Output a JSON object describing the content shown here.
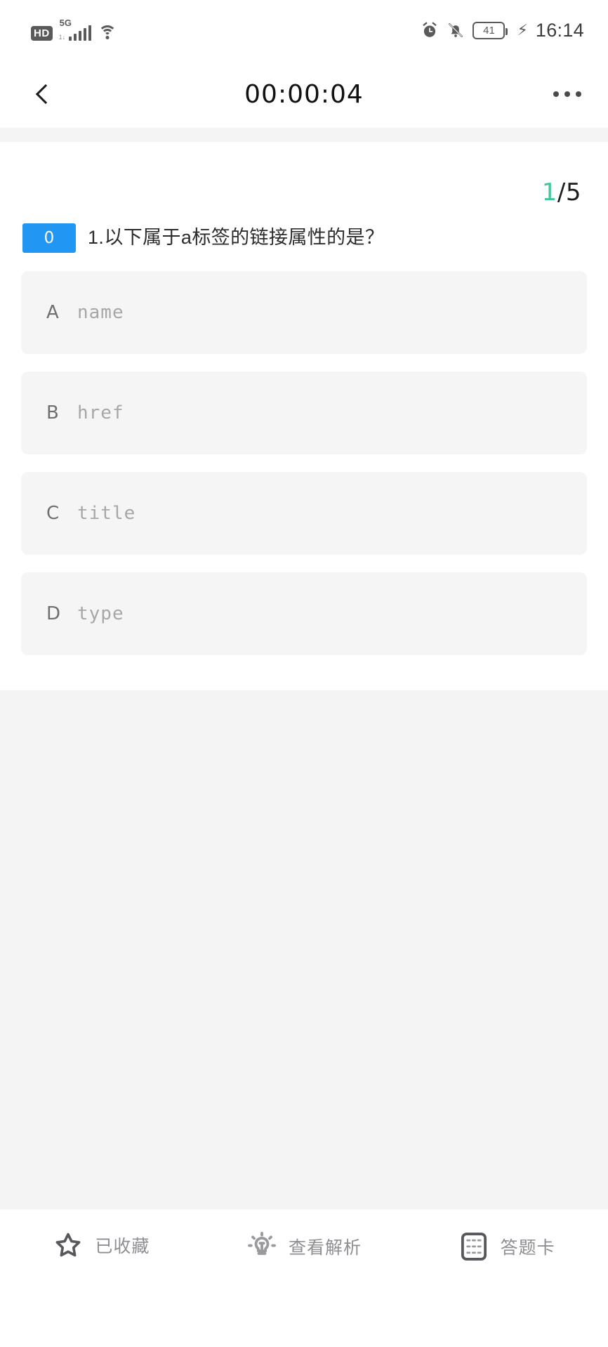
{
  "statusbar": {
    "hd_label": "HD",
    "network_label": "5G",
    "network_sub": "1↓",
    "wifi_icon": "wifi-icon",
    "alarm_icon": "alarm-clock-icon",
    "mute_icon": "bell-muted-icon",
    "battery_level": "41",
    "charging_icon": "charging-bolt-icon",
    "clock": "16:14"
  },
  "header": {
    "back_icon": "back-chevron-icon",
    "timer": "00:00:04",
    "more_icon": "more-dots-icon"
  },
  "quiz": {
    "current_index": "1",
    "total_label": "/5",
    "badge": "0",
    "question": "1.以下属于a标签的链接属性的是？",
    "options": [
      {
        "letter": "A",
        "text": "name"
      },
      {
        "letter": "B",
        "text": "href"
      },
      {
        "letter": "C",
        "text": "title"
      },
      {
        "letter": "D",
        "text": "type"
      }
    ]
  },
  "toolbar": {
    "favorite_label": "已收藏",
    "favorite_icon": "star-outline-icon",
    "analysis_label": "查看解析",
    "analysis_icon": "lightbulb-icon",
    "answercard_label": "答题卡",
    "answercard_icon": "answer-card-grid-icon"
  },
  "colors": {
    "accent_blue": "#2196f3",
    "accent_green": "#3ec79a",
    "option_bg": "#f5f5f6",
    "page_gray": "#f4f4f5"
  }
}
